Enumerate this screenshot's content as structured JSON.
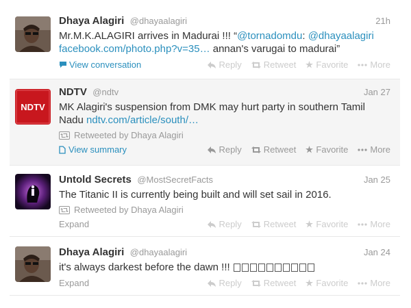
{
  "tweets": [
    {
      "name": "Dhaya Alagiri",
      "handle": "@dhayaalagiri",
      "time": "21h",
      "text_1": "Mr.M.K.ALAGIRI arrives in Madurai !!! “",
      "mention_1": "@tornadomdu",
      "text_2": ": ",
      "mention_2": "@dhayaalagiri",
      "link": "facebook.com/photo.php?v=35…",
      "text_3": " annan's varugai to madurai”",
      "footer_link": "View conversation",
      "actions": {
        "reply": "Reply",
        "retweet": "Retweet",
        "favorite": "Favorite",
        "more": "More"
      }
    },
    {
      "name": "NDTV",
      "handle": "@ndtv",
      "time": "Jan 27",
      "avatar_text": "NDTV",
      "text_1": "MK Alagiri's suspension from DMK may hurt party in southern Tamil Nadu ",
      "link": "ndtv.com/article/south/…",
      "retweeted_by": "Retweeted by Dhaya Alagiri",
      "footer_link": "View summary",
      "actions": {
        "reply": "Reply",
        "retweet": "Retweet",
        "favorite": "Favorite",
        "more": "More"
      }
    },
    {
      "name": "Untold Secrets",
      "handle": "@MostSecretFacts",
      "time": "Jan 25",
      "text_1": "The Titanic II is currently being built and will set sail in 2016.",
      "retweeted_by": "Retweeted by Dhaya Alagiri",
      "footer_link": "Expand",
      "actions": {
        "reply": "Reply",
        "retweet": "Retweet",
        "favorite": "Favorite",
        "more": "More"
      }
    },
    {
      "name": "Dhaya Alagiri",
      "handle": "@dhayaalagiri",
      "time": "Jan 24",
      "text_1": "it's always darkest before the dawn !!! ",
      "footer_link": "Expand",
      "actions": {
        "reply": "Reply",
        "retweet": "Retweet",
        "favorite": "Favorite",
        "more": "More"
      }
    }
  ],
  "colors": {
    "link": "#2a8fbd",
    "muted": "#999999",
    "ndtv_red": "#c8171e"
  }
}
